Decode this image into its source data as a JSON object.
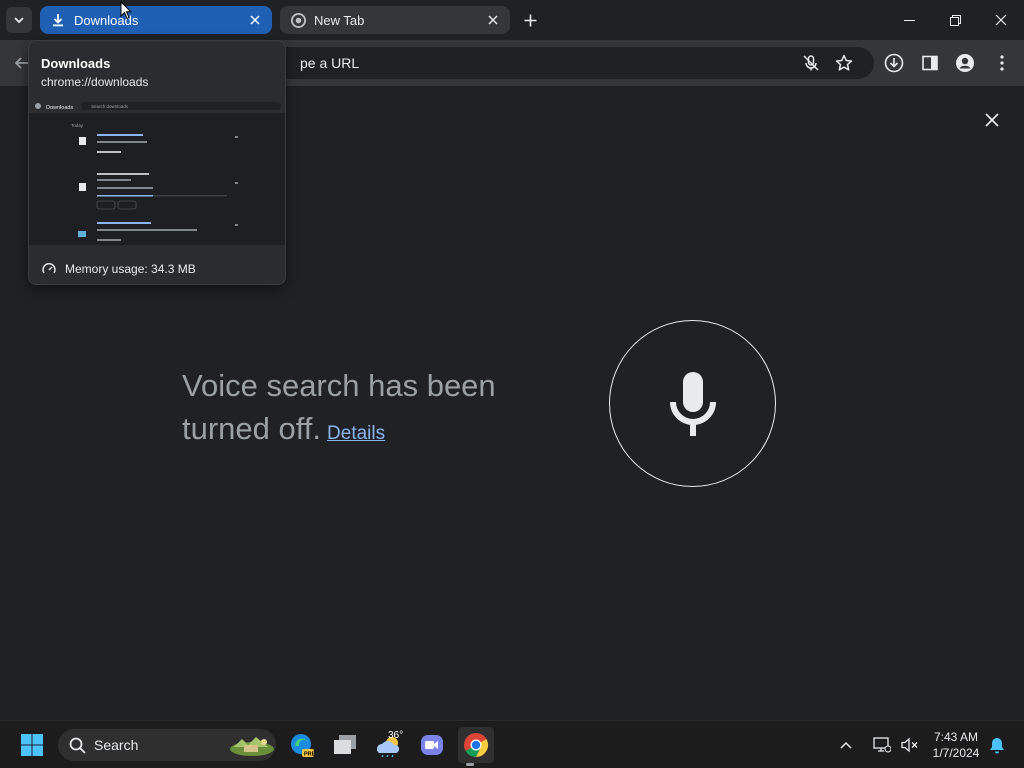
{
  "tabs": [
    {
      "title": "Downloads",
      "icon": "download-icon",
      "active": true
    },
    {
      "title": "New Tab",
      "icon": "chrome-icon",
      "active": false
    }
  ],
  "omnibox": {
    "text": "pe a URL"
  },
  "hovercard": {
    "title": "Downloads",
    "url": "chrome://downloads",
    "memory": "Memory usage: 34.3 MB",
    "preview": {
      "header": "Downloads",
      "search": "Search downloads",
      "group": "Today"
    }
  },
  "content": {
    "message": "Voice search has been turned off.",
    "details_link": "Details"
  },
  "taskbar": {
    "search_label": "Search",
    "weather_temp": "36°",
    "time": "7:43 AM",
    "date": "1/7/2024"
  },
  "colors": {
    "active_tab": "#1f5fb4",
    "link": "#8ab4f8",
    "background": "#202124"
  }
}
